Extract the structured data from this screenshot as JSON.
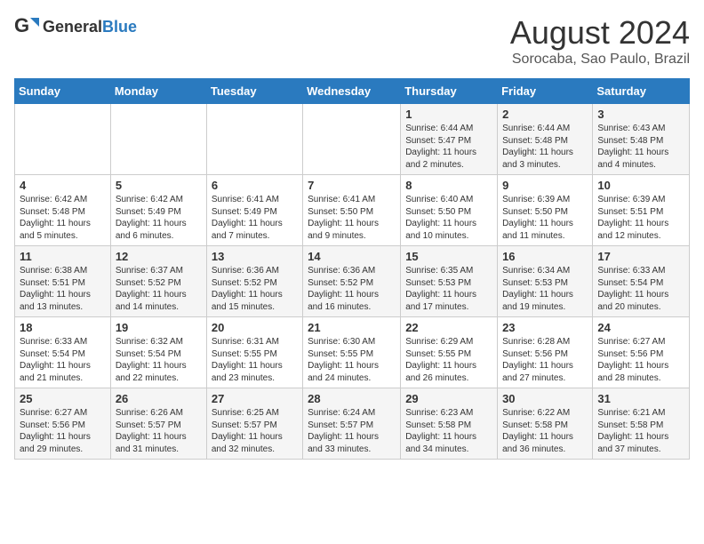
{
  "logo": {
    "general": "General",
    "blue": "Blue"
  },
  "title": "August 2024",
  "subtitle": "Sorocaba, Sao Paulo, Brazil",
  "days_of_week": [
    "Sunday",
    "Monday",
    "Tuesday",
    "Wednesday",
    "Thursday",
    "Friday",
    "Saturday"
  ],
  "weeks": [
    [
      {
        "day": "",
        "detail": ""
      },
      {
        "day": "",
        "detail": ""
      },
      {
        "day": "",
        "detail": ""
      },
      {
        "day": "",
        "detail": ""
      },
      {
        "day": "1",
        "detail": "Sunrise: 6:44 AM\nSunset: 5:47 PM\nDaylight: 11 hours and 2 minutes."
      },
      {
        "day": "2",
        "detail": "Sunrise: 6:44 AM\nSunset: 5:48 PM\nDaylight: 11 hours and 3 minutes."
      },
      {
        "day": "3",
        "detail": "Sunrise: 6:43 AM\nSunset: 5:48 PM\nDaylight: 11 hours and 4 minutes."
      }
    ],
    [
      {
        "day": "4",
        "detail": "Sunrise: 6:42 AM\nSunset: 5:48 PM\nDaylight: 11 hours and 5 minutes."
      },
      {
        "day": "5",
        "detail": "Sunrise: 6:42 AM\nSunset: 5:49 PM\nDaylight: 11 hours and 6 minutes."
      },
      {
        "day": "6",
        "detail": "Sunrise: 6:41 AM\nSunset: 5:49 PM\nDaylight: 11 hours and 7 minutes."
      },
      {
        "day": "7",
        "detail": "Sunrise: 6:41 AM\nSunset: 5:50 PM\nDaylight: 11 hours and 9 minutes."
      },
      {
        "day": "8",
        "detail": "Sunrise: 6:40 AM\nSunset: 5:50 PM\nDaylight: 11 hours and 10 minutes."
      },
      {
        "day": "9",
        "detail": "Sunrise: 6:39 AM\nSunset: 5:50 PM\nDaylight: 11 hours and 11 minutes."
      },
      {
        "day": "10",
        "detail": "Sunrise: 6:39 AM\nSunset: 5:51 PM\nDaylight: 11 hours and 12 minutes."
      }
    ],
    [
      {
        "day": "11",
        "detail": "Sunrise: 6:38 AM\nSunset: 5:51 PM\nDaylight: 11 hours and 13 minutes."
      },
      {
        "day": "12",
        "detail": "Sunrise: 6:37 AM\nSunset: 5:52 PM\nDaylight: 11 hours and 14 minutes."
      },
      {
        "day": "13",
        "detail": "Sunrise: 6:36 AM\nSunset: 5:52 PM\nDaylight: 11 hours and 15 minutes."
      },
      {
        "day": "14",
        "detail": "Sunrise: 6:36 AM\nSunset: 5:52 PM\nDaylight: 11 hours and 16 minutes."
      },
      {
        "day": "15",
        "detail": "Sunrise: 6:35 AM\nSunset: 5:53 PM\nDaylight: 11 hours and 17 minutes."
      },
      {
        "day": "16",
        "detail": "Sunrise: 6:34 AM\nSunset: 5:53 PM\nDaylight: 11 hours and 19 minutes."
      },
      {
        "day": "17",
        "detail": "Sunrise: 6:33 AM\nSunset: 5:54 PM\nDaylight: 11 hours and 20 minutes."
      }
    ],
    [
      {
        "day": "18",
        "detail": "Sunrise: 6:33 AM\nSunset: 5:54 PM\nDaylight: 11 hours and 21 minutes."
      },
      {
        "day": "19",
        "detail": "Sunrise: 6:32 AM\nSunset: 5:54 PM\nDaylight: 11 hours and 22 minutes."
      },
      {
        "day": "20",
        "detail": "Sunrise: 6:31 AM\nSunset: 5:55 PM\nDaylight: 11 hours and 23 minutes."
      },
      {
        "day": "21",
        "detail": "Sunrise: 6:30 AM\nSunset: 5:55 PM\nDaylight: 11 hours and 24 minutes."
      },
      {
        "day": "22",
        "detail": "Sunrise: 6:29 AM\nSunset: 5:55 PM\nDaylight: 11 hours and 26 minutes."
      },
      {
        "day": "23",
        "detail": "Sunrise: 6:28 AM\nSunset: 5:56 PM\nDaylight: 11 hours and 27 minutes."
      },
      {
        "day": "24",
        "detail": "Sunrise: 6:27 AM\nSunset: 5:56 PM\nDaylight: 11 hours and 28 minutes."
      }
    ],
    [
      {
        "day": "25",
        "detail": "Sunrise: 6:27 AM\nSunset: 5:56 PM\nDaylight: 11 hours and 29 minutes."
      },
      {
        "day": "26",
        "detail": "Sunrise: 6:26 AM\nSunset: 5:57 PM\nDaylight: 11 hours and 31 minutes."
      },
      {
        "day": "27",
        "detail": "Sunrise: 6:25 AM\nSunset: 5:57 PM\nDaylight: 11 hours and 32 minutes."
      },
      {
        "day": "28",
        "detail": "Sunrise: 6:24 AM\nSunset: 5:57 PM\nDaylight: 11 hours and 33 minutes."
      },
      {
        "day": "29",
        "detail": "Sunrise: 6:23 AM\nSunset: 5:58 PM\nDaylight: 11 hours and 34 minutes."
      },
      {
        "day": "30",
        "detail": "Sunrise: 6:22 AM\nSunset: 5:58 PM\nDaylight: 11 hours and 36 minutes."
      },
      {
        "day": "31",
        "detail": "Sunrise: 6:21 AM\nSunset: 5:58 PM\nDaylight: 11 hours and 37 minutes."
      }
    ]
  ]
}
